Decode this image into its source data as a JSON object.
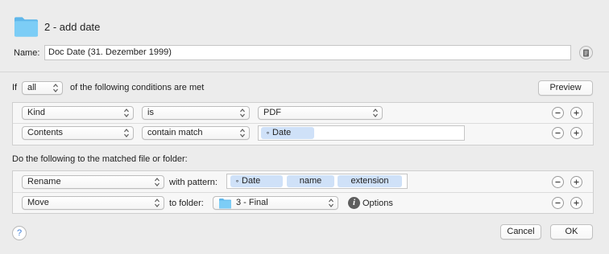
{
  "header": {
    "title": "2 - add date",
    "icon": "folder-icon"
  },
  "name_field": {
    "label": "Name:",
    "value": "Doc Date (31. Dezember 1999)"
  },
  "conditions": {
    "prefix": "If",
    "match_mode": "all",
    "suffix": "of the following conditions are met",
    "preview_label": "Preview",
    "rows": [
      {
        "attribute": "Kind",
        "operator": "is",
        "value": "PDF"
      },
      {
        "attribute": "Contents",
        "operator": "contain match",
        "value_token": "Date"
      }
    ]
  },
  "actions": {
    "heading": "Do the following to the matched file or folder:",
    "rows": [
      {
        "action": "Rename",
        "connector": "with pattern:",
        "tokens": [
          "Date",
          "name",
          "extension"
        ]
      },
      {
        "action": "Move",
        "connector": "to folder:",
        "folder": "3 - Final",
        "options_label": "Options"
      }
    ]
  },
  "footer": {
    "help_label": "?",
    "cancel_label": "Cancel",
    "ok_label": "OK"
  },
  "colors": {
    "folder": "#6cc4f2",
    "token": "#cfe1f8",
    "help": "#3f7fd9"
  }
}
